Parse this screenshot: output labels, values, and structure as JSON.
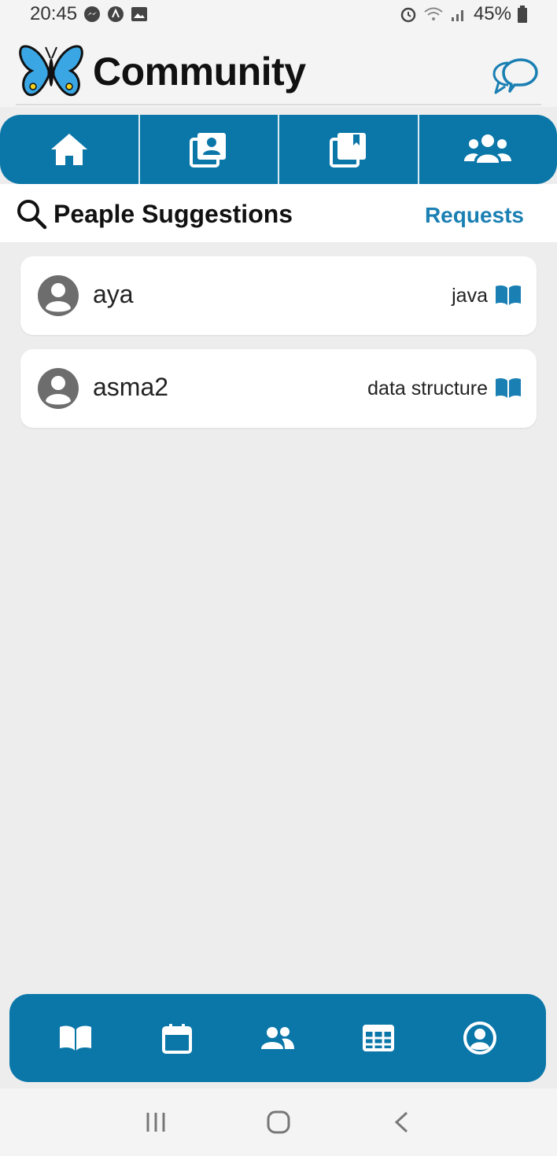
{
  "status_bar": {
    "time": "20:45",
    "battery": "45%",
    "icons_left": [
      "messenger-icon",
      "app-notification-icon",
      "gallery-icon"
    ],
    "icons_right": [
      "alarm-icon",
      "wifi-icon",
      "signal-icon",
      "battery-icon"
    ]
  },
  "header": {
    "title": "Community",
    "logo": "butterfly-logo",
    "chat_icon": "chat-bubbles-icon"
  },
  "top_tabs": [
    {
      "icon": "home-icon",
      "active": false
    },
    {
      "icon": "profile-album-icon",
      "active": false
    },
    {
      "icon": "bookmark-album-icon",
      "active": false
    },
    {
      "icon": "people-group-icon",
      "active": true
    }
  ],
  "search": {
    "label": "Peaple Suggestions",
    "requests_label": "Requests"
  },
  "suggestions": [
    {
      "name": "aya",
      "topic": "java"
    },
    {
      "name": "asma2",
      "topic": "data structure"
    }
  ],
  "bottom_nav": [
    {
      "icon": "open-book-icon"
    },
    {
      "icon": "calendar-icon"
    },
    {
      "icon": "people-icon"
    },
    {
      "icon": "table-grid-icon"
    },
    {
      "icon": "account-circle-icon"
    }
  ],
  "system_nav": [
    "recent-apps-icon",
    "home-circle-icon",
    "back-icon"
  ],
  "colors": {
    "primary": "#0b77a9",
    "link": "#1a7fb3",
    "background": "#ededed"
  }
}
